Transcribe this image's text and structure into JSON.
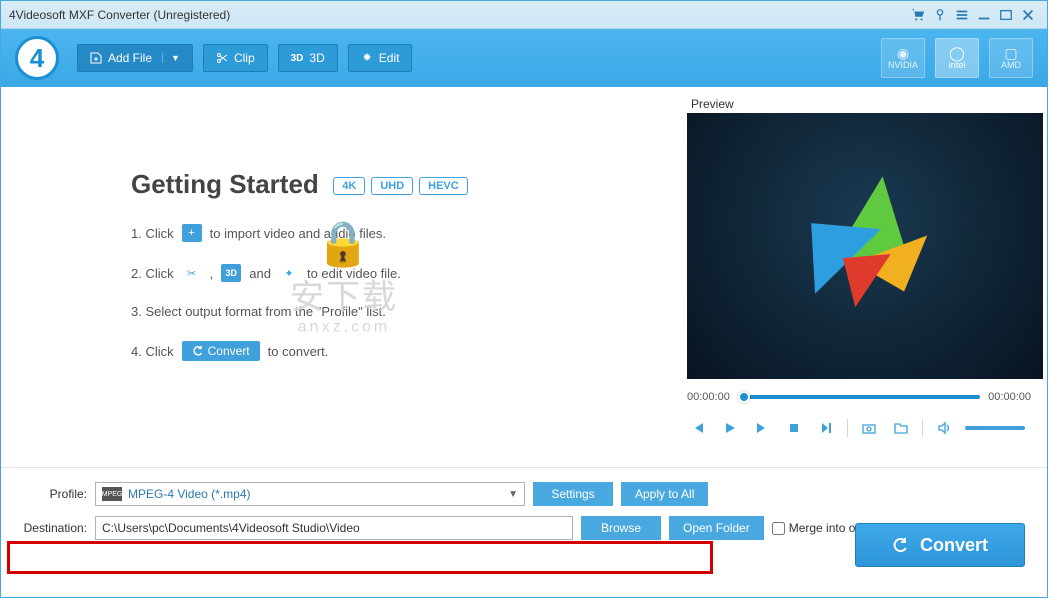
{
  "titlebar": {
    "title": "4Videosoft MXF Converter (Unregistered)"
  },
  "toolbar": {
    "logo_char": "4",
    "add_file": "Add File",
    "clip": "Clip",
    "three_d": "3D",
    "edit": "Edit",
    "chips": {
      "nvidia": "NVIDIA",
      "intel": "intel",
      "amd": "AMD"
    }
  },
  "getting_started": {
    "title": "Getting Started",
    "badges": [
      "4K",
      "UHD",
      "HEVC"
    ],
    "step1_a": "1. Click",
    "step1_b": "to import video and audio files.",
    "step2_a": "2. Click",
    "step2_comma": ",",
    "step2_and": "and",
    "step2_b": "to edit video file.",
    "step3": "3. Select output format from the \"Profile\" list.",
    "step4_a": "4. Click",
    "step4_convert": "Convert",
    "step4_b": "to convert."
  },
  "watermark": {
    "main": "安下载",
    "sub": "anxz.com"
  },
  "preview": {
    "label": "Preview",
    "time_start": "00:00:00",
    "time_end": "00:00:00"
  },
  "bottom": {
    "profile_label": "Profile:",
    "profile_value": "MPEG-4 Video (*.mp4)",
    "profile_icon_text": "MPEG",
    "settings": "Settings",
    "apply_all": "Apply to All",
    "destination_label": "Destination:",
    "destination_value": "C:\\Users\\pc\\Documents\\4Videosoft Studio\\Video",
    "browse": "Browse",
    "open_folder": "Open Folder",
    "merge": "Merge into one file",
    "convert": "Convert"
  }
}
